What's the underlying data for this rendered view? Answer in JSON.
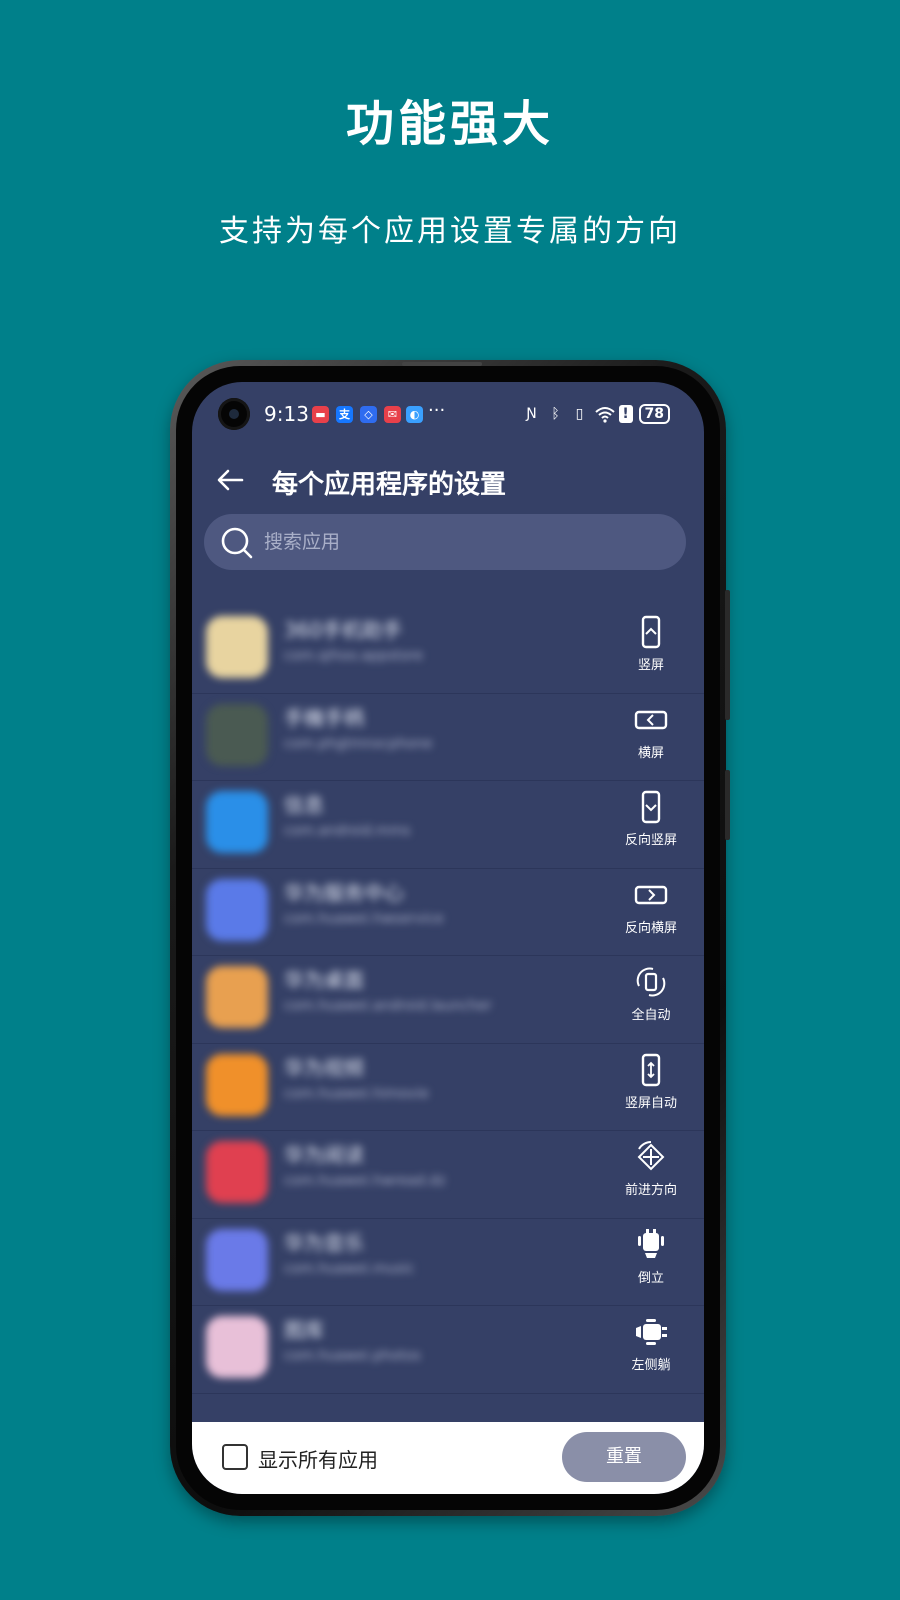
{
  "headline": "功能强大",
  "subline": "支持为每个应用设置专属的方向",
  "status_bar": {
    "time": "9:13",
    "more": "···",
    "battery": "78"
  },
  "app_bar": {
    "title": "每个应用程序的设置"
  },
  "search": {
    "placeholder": "搜索应用"
  },
  "apps": [
    {
      "name": "360手机助手",
      "package": "com.qihoo.appstore",
      "orientation": "竖屏",
      "icon_color": "#e8d4a0",
      "orient_icon": "portrait-icon"
    },
    {
      "name": "手機手柄",
      "package": "com.phgtmnxcphone",
      "orientation": "横屏",
      "icon_color": "#4a5a52",
      "orient_icon": "landscape-icon"
    },
    {
      "name": "信息",
      "package": "com.android.mms",
      "orientation": "反向竖屏",
      "icon_color": "#2a8fe8",
      "orient_icon": "reverse-portrait-icon"
    },
    {
      "name": "华为服务中心",
      "package": "com.huawei.hwservice",
      "orientation": "反向横屏",
      "icon_color": "#5a7ae8",
      "orient_icon": "reverse-landscape-icon"
    },
    {
      "name": "华为桌面",
      "package": "com.huawei.android.launcher",
      "orientation": "全自动",
      "icon_color": "#e8a050",
      "orient_icon": "full-auto-icon"
    },
    {
      "name": "华为视频",
      "package": "com.huawei.himovie",
      "orientation": "竖屏自动",
      "icon_color": "#f0902a",
      "orient_icon": "portrait-auto-icon"
    },
    {
      "name": "华为阅读",
      "package": "com.huawei.hwread.dz",
      "orientation": "前进方向",
      "icon_color": "#e04050",
      "orient_icon": "forward-direction-icon"
    },
    {
      "name": "华为音乐",
      "package": "com.huawei.music",
      "orientation": "倒立",
      "icon_color": "#6a7ae8",
      "orient_icon": "upside-down-icon"
    },
    {
      "name": "图库",
      "package": "com.huawei.photos",
      "orientation": "左侧躺",
      "icon_color": "#e8c0d8",
      "orient_icon": "lie-left-icon"
    }
  ],
  "bottom_bar": {
    "show_all_label": "显示所有应用",
    "reset_label": "重置"
  }
}
